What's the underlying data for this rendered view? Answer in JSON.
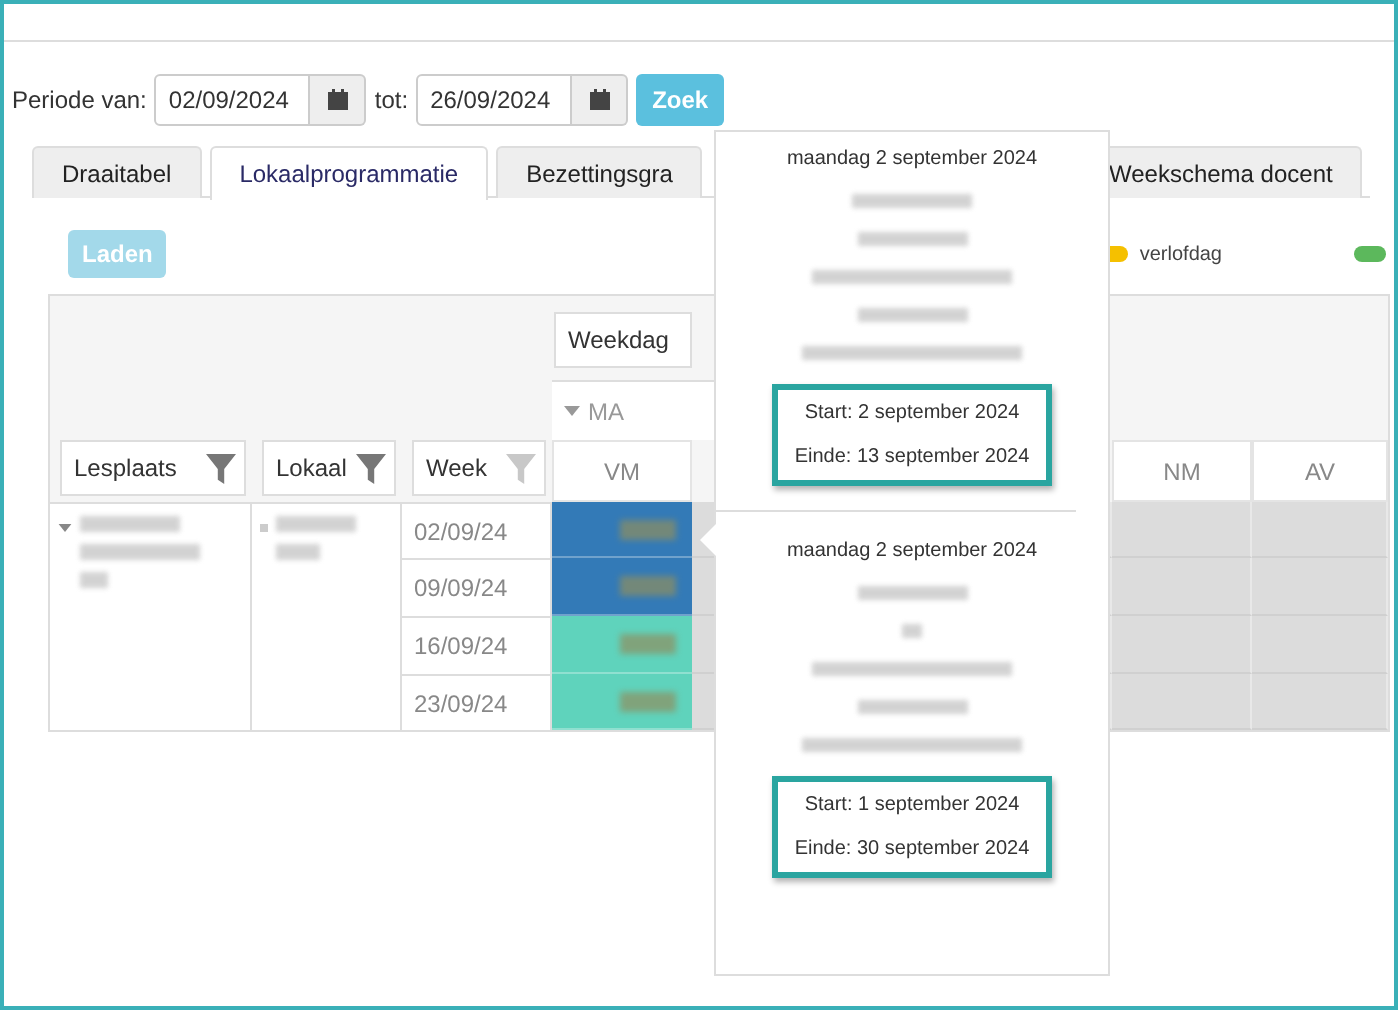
{
  "filters": {
    "from_label": "Periode van:",
    "from_value": "02/09/2024",
    "to_label": "tot:",
    "to_value": "26/09/2024",
    "search_button": "Zoek"
  },
  "tabs": [
    {
      "label": "Draaitabel",
      "selected": false
    },
    {
      "label": "Lokaalprogrammatie",
      "selected": true
    },
    {
      "label": "Bezettingsgra",
      "selected": false
    },
    {
      "label": "Weekschema docent",
      "selected": false
    }
  ],
  "load_button": {
    "label": "Laden",
    "disabled": true
  },
  "legend": [
    {
      "label": "verlofdag",
      "color": "#f5c000"
    },
    {
      "color": "#5cb85c"
    }
  ],
  "table": {
    "weekday_filter": "Weekdag",
    "day": "MA",
    "row_headers": [
      "Lesplaats",
      "Lokaal",
      "Week"
    ],
    "slots": [
      "VM",
      "NM",
      "AV"
    ],
    "rows": [
      {
        "week": "02/09/24",
        "color": "#337ab7"
      },
      {
        "week": "09/09/24",
        "color": "#337ab7"
      },
      {
        "week": "16/09/24",
        "color": "#5fd3bc"
      },
      {
        "week": "23/09/24",
        "color": "#5fd3bc"
      }
    ]
  },
  "popup": {
    "entries": [
      {
        "date": "maandag 2 september 2024",
        "start": "Start: 2 september 2024",
        "end": "Einde: 13 september 2024"
      },
      {
        "date": "maandag 2 september 2024",
        "start": "Start: 1 september 2024",
        "end": "Einde: 30 september 2024"
      }
    ]
  }
}
